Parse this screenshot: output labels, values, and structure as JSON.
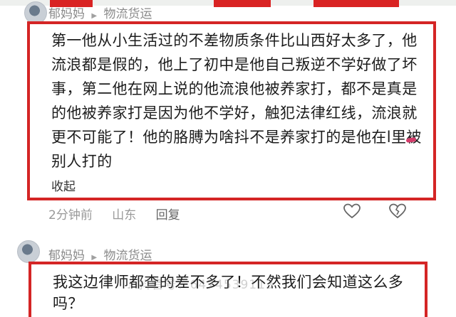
{
  "comment1": {
    "username": "郁妈妈",
    "tag": "物流货运",
    "text": "第一他从小生活过的不差物质条件比山西好太多了，他流浪都是假的，他上了初中是他自己叛逆不学好做了坏事，第二他在网上说的他流浪他被养家打，都不是真是的他被养家打是因为他不学好，触犯法律红线，流浪就更不可能了！他的胳膊为啥抖不是养家打的是他在l里被别人打的",
    "collapse_label": "收起",
    "time": "2分钟前",
    "location": "山东",
    "reply_label": "回复",
    "like_icon": "heart-outline",
    "dislike_icon": "broken-heart-outline"
  },
  "comment2": {
    "username": "郁妈妈",
    "tag": "物流货运",
    "text": "我这边律师都查的差不多了！不然我们会知道这么多吗？"
  },
  "watermark": {
    "text": "抖音号：6474539113"
  },
  "colors": {
    "highlight_border": "#d42525",
    "meta_text": "#999999"
  }
}
